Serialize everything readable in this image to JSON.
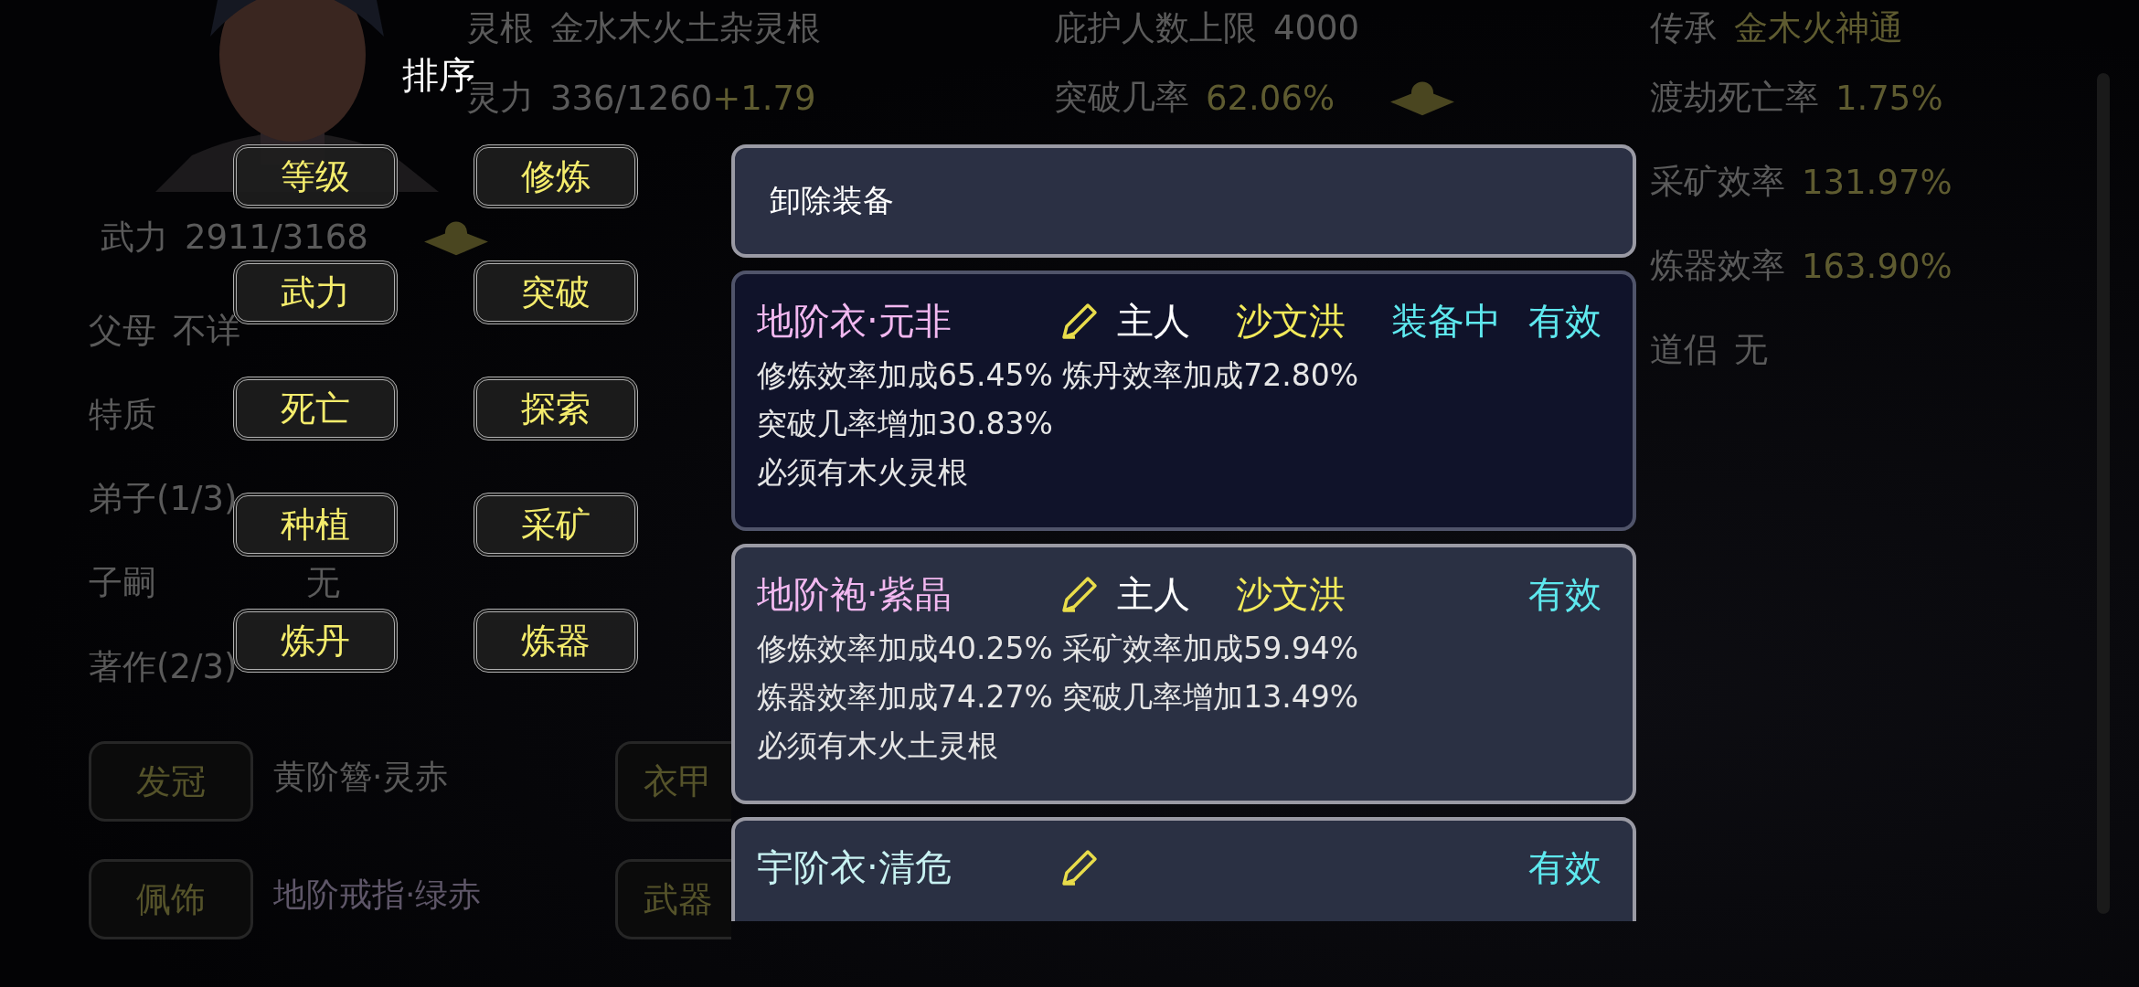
{
  "stat_columns": [
    [
      {
        "label": "灵根",
        "value": "金水木火土杂灵根",
        "highlight": false
      },
      {
        "label": "灵力",
        "value": "336/1260",
        "bonus": "+1.79",
        "highlight": false
      }
    ],
    [
      {
        "label": "庇护人数上限",
        "value": "4000",
        "highlight": false
      },
      {
        "label": "突破几率",
        "value": "62.06%",
        "highlight": true,
        "badge": true
      }
    ],
    [
      {
        "label": "传承",
        "value": "金木火神通",
        "highlight": true
      },
      {
        "label": "渡劫死亡率",
        "value": "1.75%",
        "highlight": true
      },
      {
        "label": "采矿效率",
        "value": "131.97%",
        "highlight": true
      },
      {
        "label": "炼器效率",
        "value": "163.90%",
        "highlight": true
      },
      {
        "label": "道侣",
        "value": "无",
        "highlight": false
      }
    ]
  ],
  "might": {
    "label": "武力",
    "value": "2911/3168",
    "highlight": false,
    "badge": true
  },
  "details": [
    {
      "kind": "inline",
      "label": "父母",
      "value": "不详",
      "highlight": false
    },
    {
      "kind": "column",
      "label": "特质"
    },
    {
      "kind": "column",
      "label": "弟子(1/3)"
    },
    {
      "kind": "column",
      "label": "子嗣",
      "value": "无",
      "highlight": false
    },
    {
      "kind": "column",
      "label": "著作(2/3)"
    }
  ],
  "equip_rows": [
    {
      "slots": [
        {
          "slot": "发冠",
          "item": "黄阶簪·灵赤",
          "color": "#5a5a5a"
        },
        {
          "slot": "衣甲"
        }
      ]
    },
    {
      "slots": [
        {
          "slot": "佩饰",
          "item": "地阶戒指·绿赤",
          "color": "#5e5668"
        },
        {
          "slot": "武器"
        }
      ]
    }
  ],
  "sort_menu": {
    "title": "排序",
    "options": [
      {
        "label": "等级"
      },
      {
        "label": "修炼"
      },
      {
        "label": "武力"
      },
      {
        "label": "突破"
      },
      {
        "label": "死亡"
      },
      {
        "label": "探索"
      },
      {
        "label": "种植"
      },
      {
        "label": "采矿"
      },
      {
        "label": "炼丹"
      },
      {
        "label": "炼器"
      }
    ]
  },
  "equipment_panel": {
    "unequip_button": "卸除装备",
    "items": [
      {
        "name": "地阶衣·元非",
        "color": "#f2b8f0",
        "selected": true,
        "owner_label": "主人",
        "owner": "沙文洪",
        "status": "装备中",
        "validity": "有效",
        "effects": [
          "修炼效率加成65.45% 炼丹效率加成72.80%",
          "突破几率增加30.83%",
          "必须有木火灵根"
        ]
      },
      {
        "name": "地阶袍·紫晶",
        "color": "#f2b8f0",
        "selected": false,
        "owner_label": "主人",
        "owner": "沙文洪",
        "validity": "有效",
        "effects": [
          "修炼效率加成40.25% 采矿效率加成59.94%",
          "炼器效率加成74.27% 突破几率增加13.49%",
          "必须有木火土灵根"
        ]
      },
      {
        "name": "宇阶衣·清危",
        "color": "#c8f2f2",
        "selected": false,
        "validity": "有效"
      }
    ]
  }
}
